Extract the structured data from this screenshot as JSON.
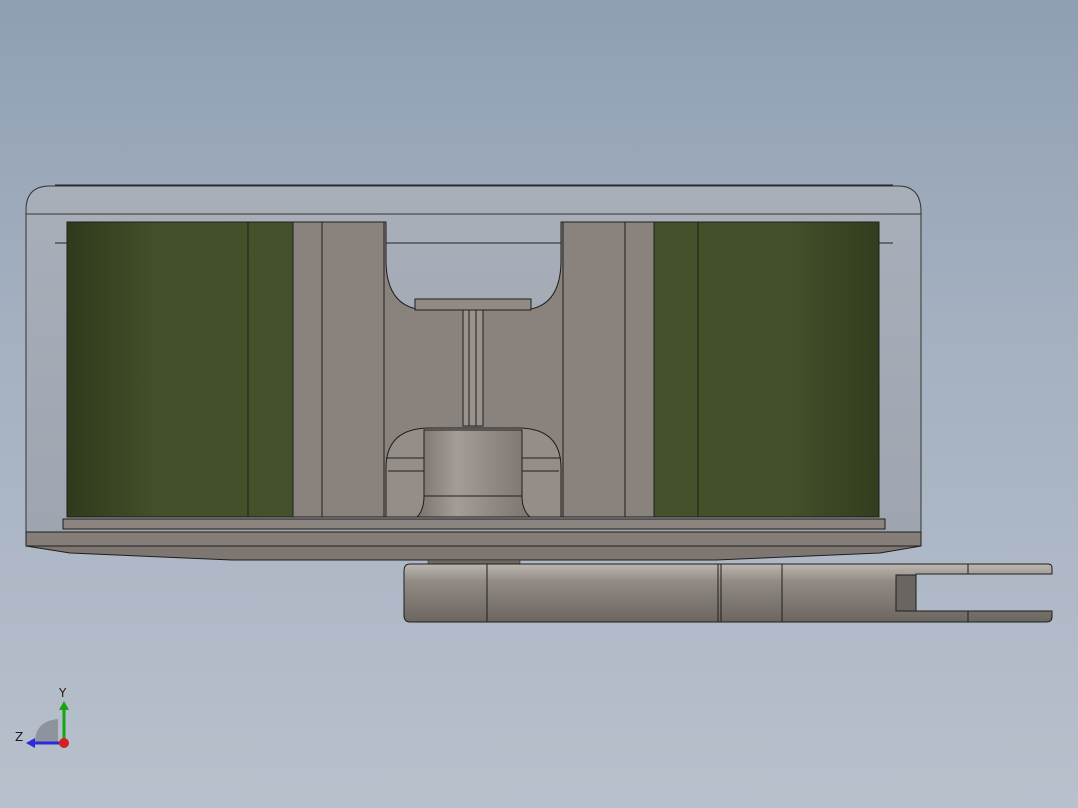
{
  "viewport": {
    "background_top": "#8f9fb3",
    "background_bottom": "#b8c0cc"
  },
  "model": {
    "housing_color": "#a3a9b3",
    "coil_color": "#43502a",
    "core_color": "#8a837d",
    "base_color": "#857e78",
    "outline_color": "#1e1e1e"
  },
  "triad": {
    "y_label": "Y",
    "z_label": "Z",
    "y_color": "#17a317",
    "z_color": "#2a2ad8",
    "x_color": "#d42020"
  }
}
